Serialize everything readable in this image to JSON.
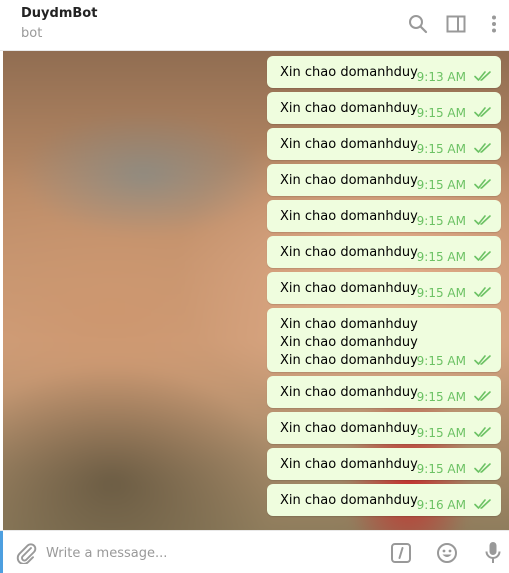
{
  "header": {
    "title": "DuydmBot",
    "subtitle": "bot",
    "actions": [
      "search-icon",
      "sidebar-toggle-icon",
      "more-vertical-icon"
    ]
  },
  "messages": [
    {
      "text": "Xin chao domanhduy",
      "time": "9:13 AM",
      "status": "read"
    },
    {
      "text": "Xin chao domanhduy",
      "time": "9:15 AM",
      "status": "read"
    },
    {
      "text": "Xin chao domanhduy",
      "time": "9:15 AM",
      "status": "read"
    },
    {
      "text": "Xin chao domanhduy",
      "time": "9:15 AM",
      "status": "read"
    },
    {
      "text": "Xin chao domanhduy",
      "time": "9:15 AM",
      "status": "read"
    },
    {
      "text": "Xin chao domanhduy",
      "time": "9:15 AM",
      "status": "read"
    },
    {
      "text": "Xin chao domanhduy",
      "time": "9:15 AM",
      "status": "read"
    },
    {
      "text": "Xin chao domanhduy\nXin chao domanhduy\nXin chao domanhduy",
      "time": "9:15 AM",
      "status": "read"
    },
    {
      "text": "Xin chao domanhduy",
      "time": "9:15 AM",
      "status": "read"
    },
    {
      "text": "Xin chao domanhduy",
      "time": "9:15 AM",
      "status": "read"
    },
    {
      "text": "Xin chao domanhduy",
      "time": "9:15 AM",
      "status": "read"
    },
    {
      "text": "Xin chao domanhduy",
      "time": "9:16 AM",
      "status": "read"
    }
  ],
  "composer": {
    "placeholder": "Write a message...",
    "value": "",
    "icons": [
      "attach-icon",
      "bot-commands-icon",
      "emoji-icon",
      "microphone-icon"
    ]
  },
  "colors": {
    "bubble": "#effdde",
    "time": "#6cc264",
    "accent": "#4d9fe0",
    "icon": "#999999"
  }
}
